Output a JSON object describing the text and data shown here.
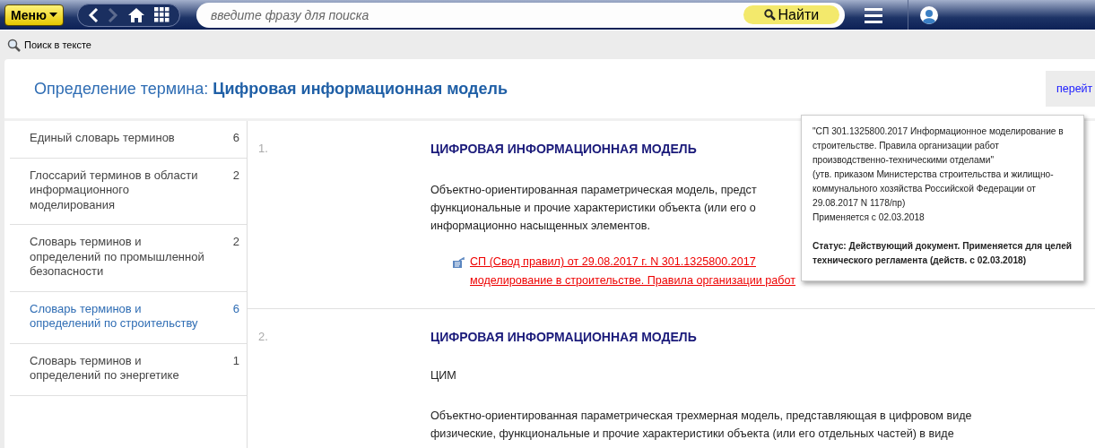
{
  "topbar": {
    "menu_button": "Меню",
    "search": {
      "placeholder": "введите фразу для поиска"
    },
    "find_button": "Найти"
  },
  "toolbar": {
    "search_in_text": "Поиск в тексте"
  },
  "header": {
    "title_prefix": "Определение термина:",
    "title_term": "Цифровая информационная модель",
    "goto_button": "перейт"
  },
  "sidebar": {
    "items": [
      {
        "label": "Единый словарь терминов",
        "count": "6",
        "selected": false
      },
      {
        "label": "Глоссарий терминов в области информационного моделирования",
        "count": "2",
        "selected": false
      },
      {
        "label": "Словарь терминов и определений по промышленной безопасности",
        "count": "2",
        "selected": false
      },
      {
        "label": "Словарь терминов и определений по строительству",
        "count": "6",
        "selected": true
      },
      {
        "label": "Словарь терминов и определений по энергетике",
        "count": "1",
        "selected": false
      }
    ]
  },
  "definitions": [
    {
      "number": "1.",
      "term": "ЦИФРОВАЯ ИНФОРМАЦИОННАЯ МОДЕЛЬ",
      "lines": [
        "Объектно-ориентированная параметрическая модель, предст",
        "функциональные и прочие характеристики объекта (или его о",
        "информационно насыщенных элементов."
      ],
      "source_lines": [
        "СП (Свод правил) от 29.08.2017 г. N 301.1325800.2017",
        "моделирование в строительстве. Правила организации работ"
      ]
    },
    {
      "number": "2.",
      "term": "ЦИФРОВАЯ ИНФОРМАЦИОННАЯ МОДЕЛЬ",
      "abbreviation": "ЦИМ",
      "lines": [
        "Объектно-ориентированная параметрическая трехмерная модель, представляющая в цифровом виде",
        "физические, функциональные и прочие характеристики объекта (или его отдельных частей) в виде"
      ]
    }
  ],
  "tooltip": {
    "document": "\"СП 301.1325800.2017 Информационное моделирование в строительстве. Правила организации работ производственно-техническими отделами\"",
    "approval": "(утв. приказом Министерства строительства и жилищно-коммунального хозяйства Российской Федерации от 29.08.2017 N 1178/пр)",
    "applies": "Применяется с 02.03.2018",
    "status": "Статус: Действующий документ. Применяется для целей технического регламента (действ. с 02.03.2018)"
  }
}
